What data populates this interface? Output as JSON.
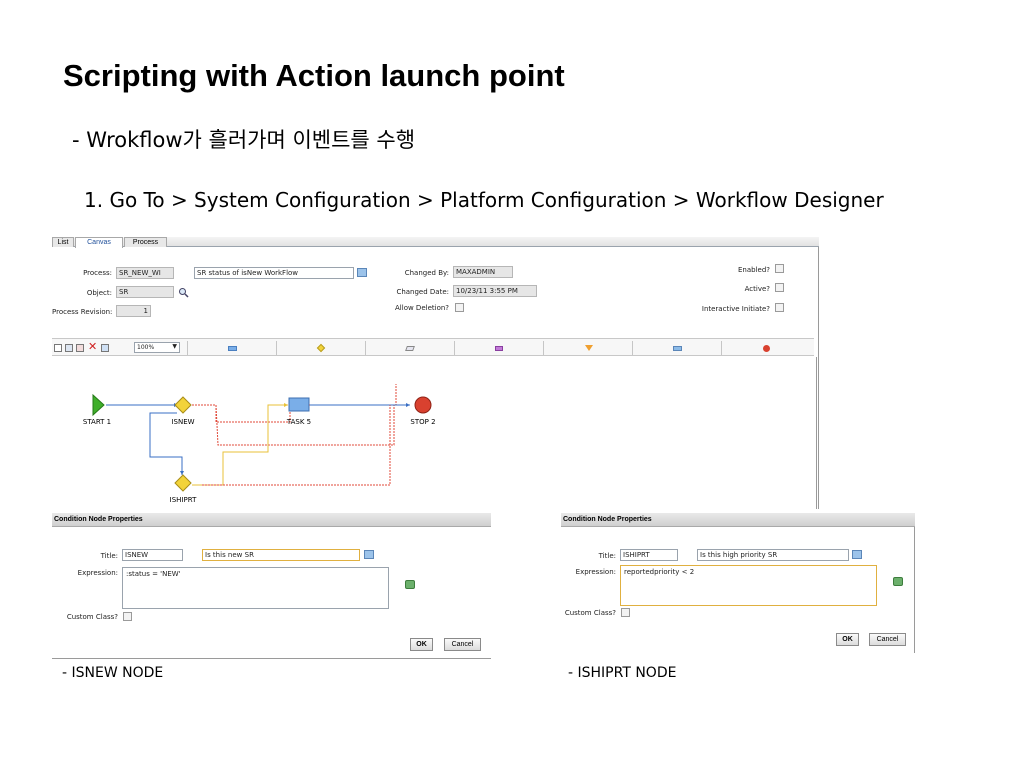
{
  "slide": {
    "title": "Scripting with Action launch point",
    "subtitle": "- Wrokflow가 흘러가며 이벤트를 수행",
    "step": "1. Go To > System Configuration > Platform Configuration > Workflow Designer",
    "caption_left": "- ISNEW NODE",
    "caption_right": "- ISHIPRT NODE"
  },
  "app": {
    "tabs": [
      "List",
      "Canvas",
      "Process"
    ],
    "active_tab": "Canvas",
    "header": {
      "process_label": "Process:",
      "process_value": "SR_NEW_WI",
      "process_desc": "SR status of isNew WorkFlow",
      "object_label": "Object:",
      "object_value": "SR",
      "revision_label": "Process Revision:",
      "revision_value": "1",
      "changed_by_label": "Changed By:",
      "changed_by_value": "MAXADMIN",
      "changed_date_label": "Changed Date:",
      "changed_date_value": "10/23/11 3:55 PM",
      "allow_deletion_label": "Allow Deletion?",
      "enabled_label": "Enabled?",
      "active_label": "Active?",
      "interactive_label": "Interactive Initiate?"
    },
    "toolbar": {
      "zoom": "100%"
    },
    "nodes": {
      "start": "START 1",
      "isnew": "ISNEW",
      "task": "TASK 5",
      "stop": "STOP 2",
      "ishiprt": "ISHIPRT"
    },
    "colors": {
      "start": "#3fae2a",
      "condition": "#f2d33a",
      "task": "#7aaee8",
      "stop": "#d9412f",
      "positive_line": "#3a6fc4",
      "negative_line": "#e04a3a",
      "alt_line": "#e8c23a"
    }
  },
  "dialog_left": {
    "header": "Condition Node Properties",
    "title_label": "Title:",
    "title_value": "ISNEW",
    "desc_value": "Is this new SR",
    "expression_label": "Expression:",
    "expression_value": ":status = 'NEW'",
    "custom_class_label": "Custom Class?",
    "ok": "OK",
    "cancel": "Cancel"
  },
  "dialog_right": {
    "header": "Condition Node Properties",
    "title_label": "Title:",
    "title_value": "ISHIPRT",
    "desc_value": "Is this high priority SR",
    "expression_label": "Expression:",
    "expression_value": "reportedpriority < 2",
    "custom_class_label": "Custom Class?",
    "ok": "OK",
    "cancel": "Cancel"
  }
}
